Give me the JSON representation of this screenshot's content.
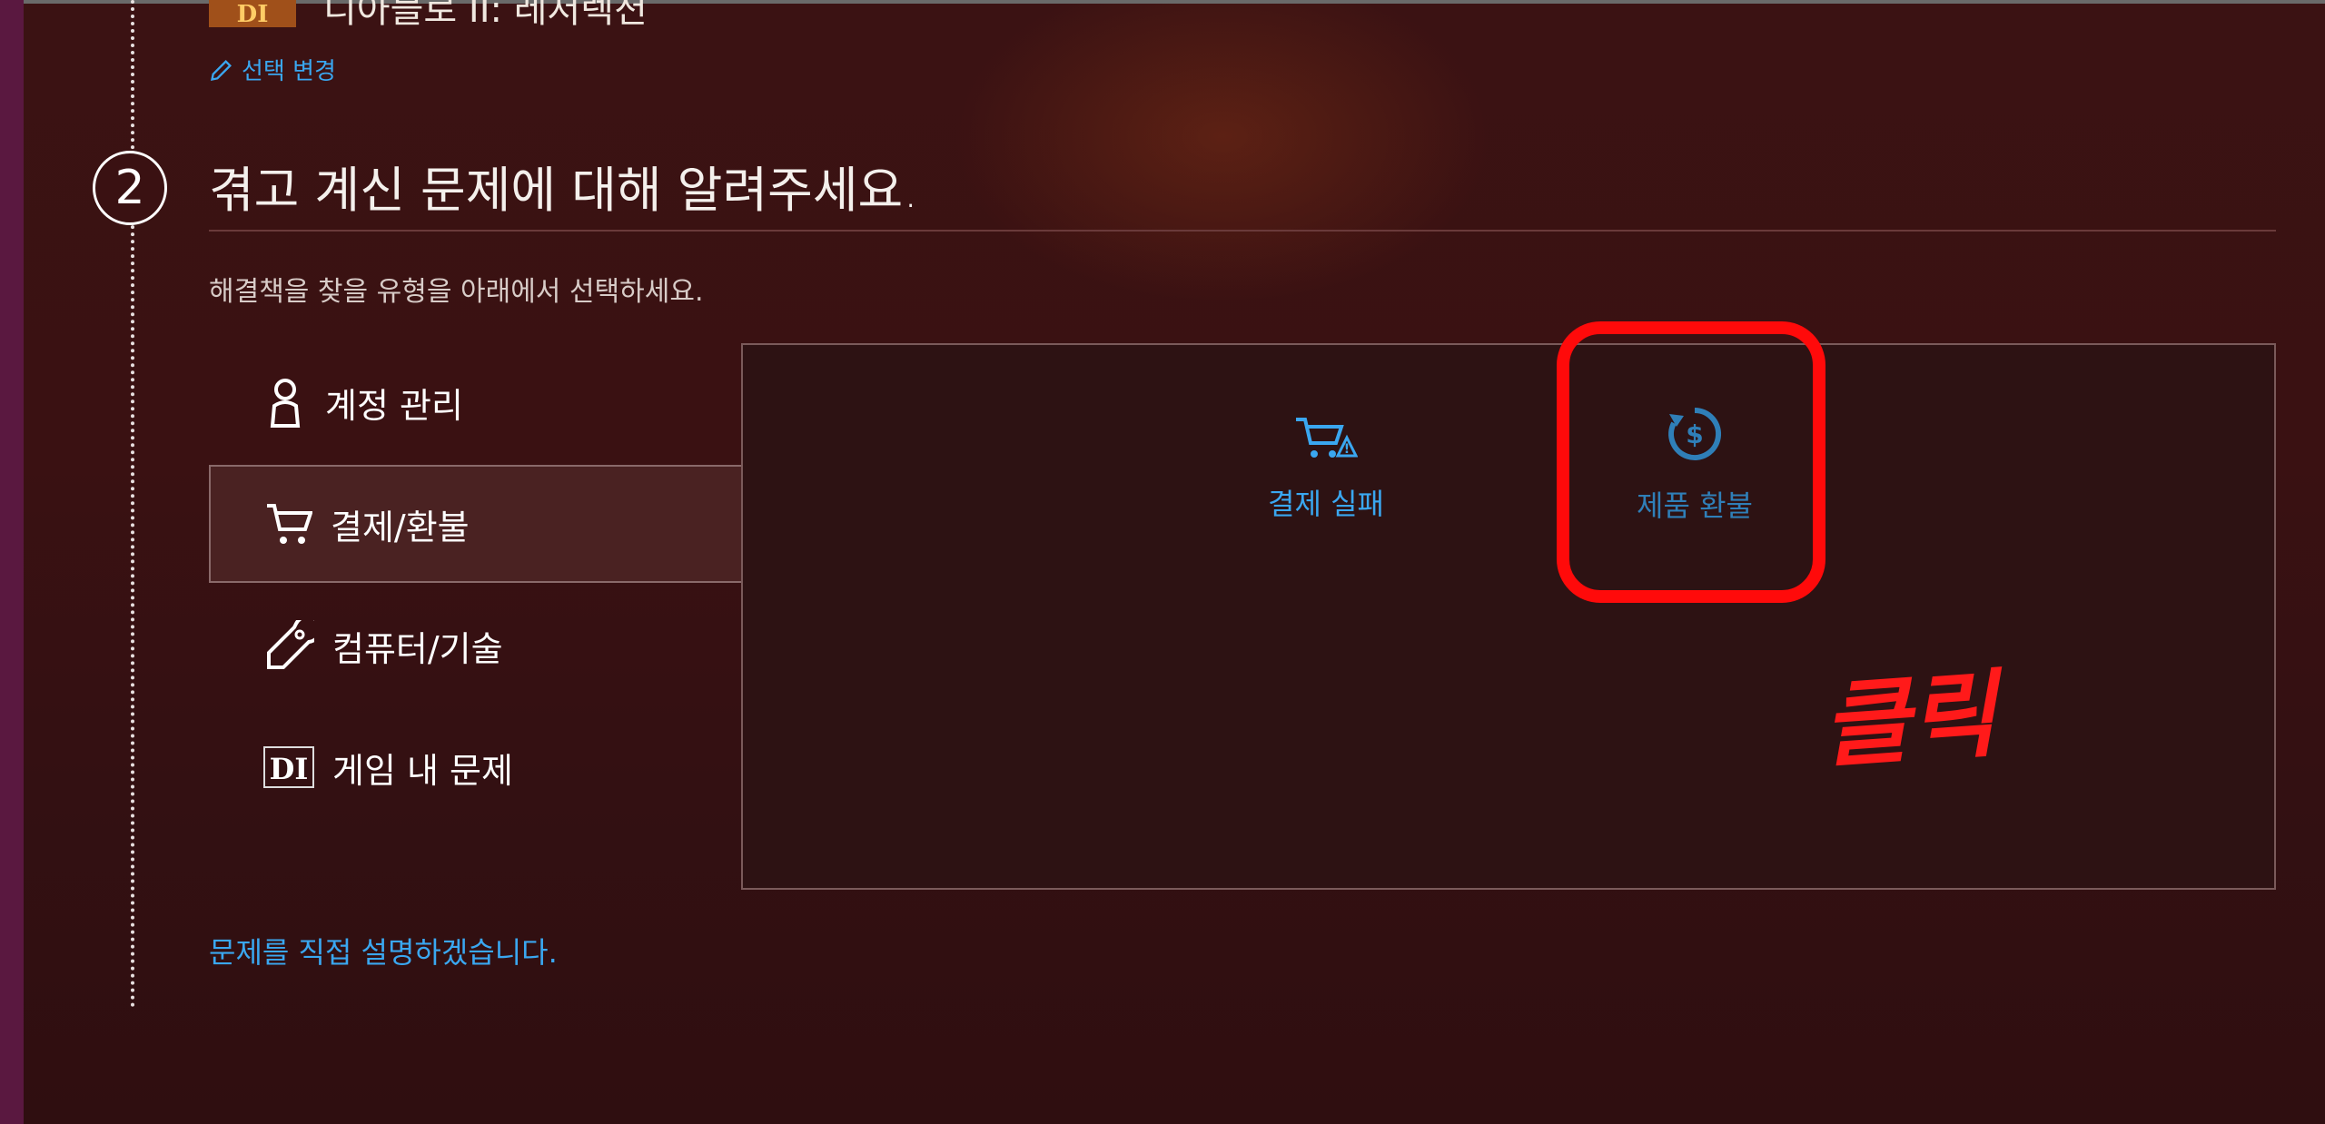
{
  "product": {
    "name": "디아블로 II: 레저렉션",
    "change_label": "선택 변경"
  },
  "step": {
    "number": "2",
    "title": "겪고 계신 문제에 대해 알려주세요.",
    "instruction": "해결책을 찾을 유형을 아래에서 선택하세요."
  },
  "categories": [
    {
      "label": "계정 관리",
      "icon": "person-icon"
    },
    {
      "label": "결제/환불",
      "icon": "cart-icon",
      "selected": true
    },
    {
      "label": "컴퓨터/기술",
      "icon": "wrench-icon"
    },
    {
      "label": "게임 내 문제",
      "icon": "diablo-logo-icon"
    }
  ],
  "options": [
    {
      "label": "결제 실패",
      "icon": "cart-warning-icon",
      "color": "#3aa7f0"
    },
    {
      "label": "제품 환불",
      "icon": "refund-dollar-icon",
      "color": "#2f7fb8"
    }
  ],
  "annotation": {
    "text": "클릭",
    "color": "#ff0a0a"
  },
  "describe_link": "문제를 직접 설명하겠습니다."
}
